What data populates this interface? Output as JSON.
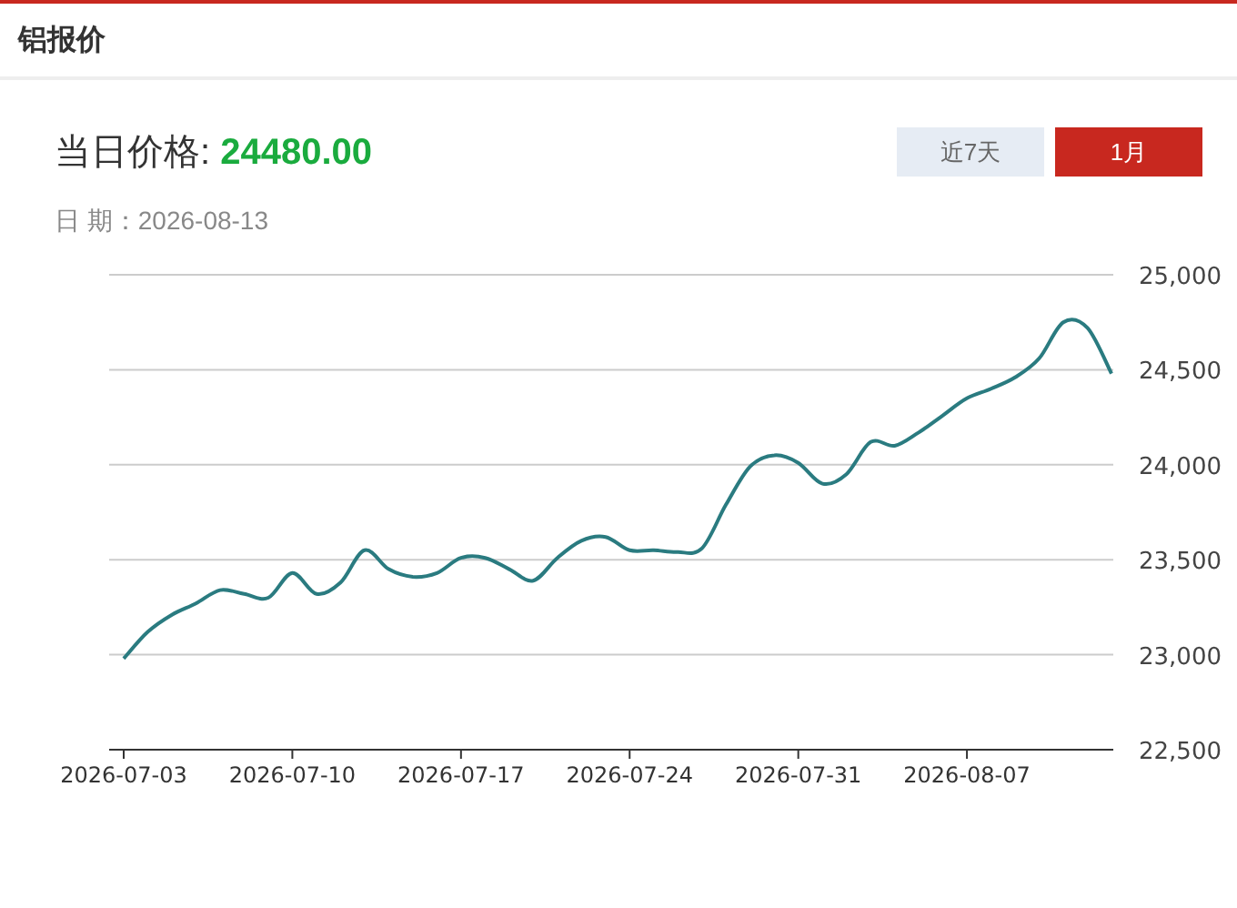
{
  "header": {
    "title": "铝报价"
  },
  "price": {
    "label": "当日价格:",
    "value": "24480.00"
  },
  "date": {
    "label": "日 期：",
    "value": "2026-08-13"
  },
  "range_buttons": [
    {
      "label": "近7天",
      "selected": false
    },
    {
      "label": "1月",
      "selected": true
    }
  ],
  "chart_data": {
    "type": "line",
    "grid": true,
    "categories": [
      "2026-07-03",
      null,
      null,
      null,
      null,
      null,
      null,
      "2026-07-10",
      null,
      null,
      null,
      null,
      null,
      null,
      "2026-07-17",
      null,
      null,
      null,
      null,
      null,
      null,
      "2026-07-24",
      null,
      null,
      null,
      null,
      null,
      null,
      "2026-07-31",
      null,
      null,
      null,
      null,
      null,
      null,
      "2026-08-07",
      null,
      null,
      null,
      null,
      null,
      null
    ],
    "series": [
      {
        "color": "#2a7b80",
        "values": [
          22980,
          23120,
          23210,
          23270,
          23340,
          23320,
          23300,
          23430,
          23320,
          23380,
          23550,
          23450,
          23410,
          23430,
          23510,
          23510,
          23450,
          23390,
          23510,
          23600,
          23620,
          23550,
          23550,
          23540,
          23560,
          23790,
          23990,
          24050,
          24010,
          23900,
          23950,
          24120,
          24100,
          24170,
          24260,
          24350,
          24400,
          24460,
          24560,
          24750,
          24720,
          24480
        ]
      }
    ],
    "ylim": [
      22500,
      25000
    ],
    "yticks": [
      {
        "value": 22500,
        "label": "22,500"
      },
      {
        "value": 23000,
        "label": "23,000"
      },
      {
        "value": 23500,
        "label": "23,500"
      },
      {
        "value": 24000,
        "label": "24,000"
      },
      {
        "value": 24500,
        "label": "24,500"
      },
      {
        "value": 25000,
        "label": "25,000"
      }
    ]
  }
}
